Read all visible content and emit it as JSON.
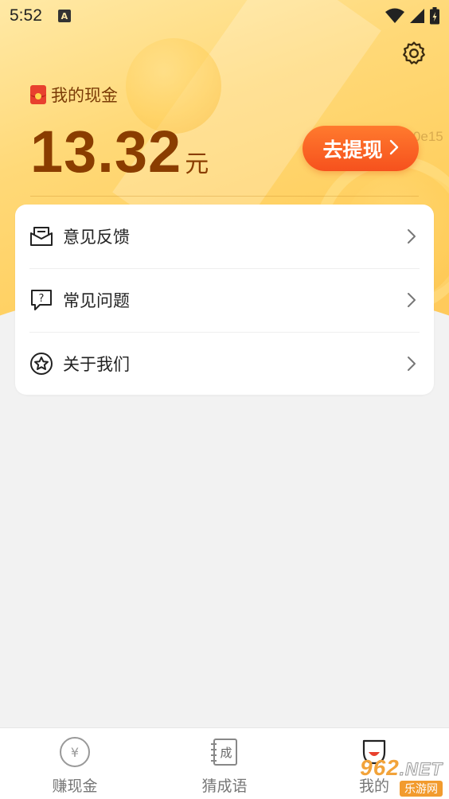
{
  "status_bar": {
    "time": "5:52",
    "notification_icon": "A"
  },
  "wallet": {
    "label": "我的现金",
    "amount": "13.32",
    "unit": "元",
    "withdraw_label": "去提现",
    "watermark_code": "1a0e15"
  },
  "menu": {
    "items": [
      {
        "label": "意见反馈",
        "icon": "mail-feedback-icon"
      },
      {
        "label": "常见问题",
        "icon": "question-bubble-icon"
      },
      {
        "label": "关于我们",
        "icon": "star-circle-icon"
      }
    ]
  },
  "bottom_nav": {
    "items": [
      {
        "label": "赚现金",
        "icon": "yen-coin-icon"
      },
      {
        "label": "猜成语",
        "icon": "idiom-book-icon"
      },
      {
        "label": "我的",
        "icon": "profile-icon"
      }
    ]
  },
  "site_watermark": {
    "brand": "962",
    "suffix": ".NET",
    "subtitle": "乐游网"
  },
  "colors": {
    "accent": "#f6511d",
    "amount_text": "#8a3d00",
    "hero_bg": "#ffd978",
    "page_bg": "#f2f2f2"
  }
}
